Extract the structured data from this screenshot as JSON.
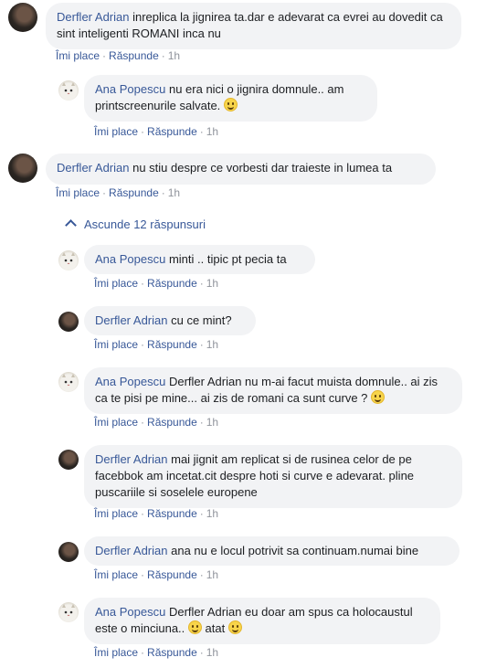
{
  "comments": [
    {
      "author": "Derfler Adrian",
      "text": "inreplica la jignirea ta.dar e adevarat ca evrei au dovedit ca sint inteligenti ROMANI inca nu",
      "emoji": false,
      "like": "Îmi place",
      "reply": "Răspunde",
      "time": "1h",
      "avatar": "man"
    },
    {
      "author": "Ana Popescu",
      "text": "nu era nici o jignira domnule.. am printscreenurile salvate.",
      "emoji": true,
      "like": "Îmi place",
      "reply": "Răspunde",
      "time": "1h",
      "avatar": "cat"
    },
    {
      "author": "Derfler Adrian",
      "text": "nu stiu despre ce vorbesti dar traieste in lumea ta",
      "emoji": false,
      "like": "Îmi place",
      "reply": "Răspunde",
      "time": "1h",
      "avatar": "man"
    },
    {
      "author": "Ana Popescu",
      "text": "minti .. tipic pt pecia ta",
      "emoji": false,
      "like": "Îmi place",
      "reply": "Răspunde",
      "time": "1h",
      "avatar": "cat"
    },
    {
      "author": "Derfler Adrian",
      "text": "cu ce mint?",
      "emoji": false,
      "like": "Îmi place",
      "reply": "Răspunde",
      "time": "1h",
      "avatar": "man"
    },
    {
      "author": "Ana Popescu",
      "text": "Derfler Adrian nu m-ai facut muista domnule.. ai zis ca te pisi pe mine... ai zis de romani ca sunt curve ?",
      "emoji": true,
      "like": "Îmi place",
      "reply": "Răspunde",
      "time": "1h",
      "avatar": "cat"
    },
    {
      "author": "Derfler Adrian",
      "text": "mai jignit am replicat si de rusinea celor de pe facebbok am incetat.cit despre hoti si curve e adevarat. pline puscariile si soselele europene",
      "emoji": false,
      "like": "Îmi place",
      "reply": "Răspunde",
      "time": "1h",
      "avatar": "man"
    },
    {
      "author": "Derfler Adrian",
      "text": "ana nu e locul potrivit sa continuam.numai bine",
      "emoji": false,
      "like": "Îmi place",
      "reply": "Răspunde",
      "time": "1h",
      "avatar": "man"
    },
    {
      "author": "Ana Popescu",
      "text": "Derfler Adrian eu doar am spus ca holocaustul este o minciuna..",
      "emoji": true,
      "text2": "atat",
      "emoji2": true,
      "like": "Îmi place",
      "reply": "Răspunde",
      "time": "1h",
      "avatar": "cat"
    }
  ],
  "hide_replies_label": "Ascunde 12 răspunsuri",
  "colors": {
    "link": "#385898",
    "bubble": "#f2f3f5",
    "meta": "#90949c"
  }
}
